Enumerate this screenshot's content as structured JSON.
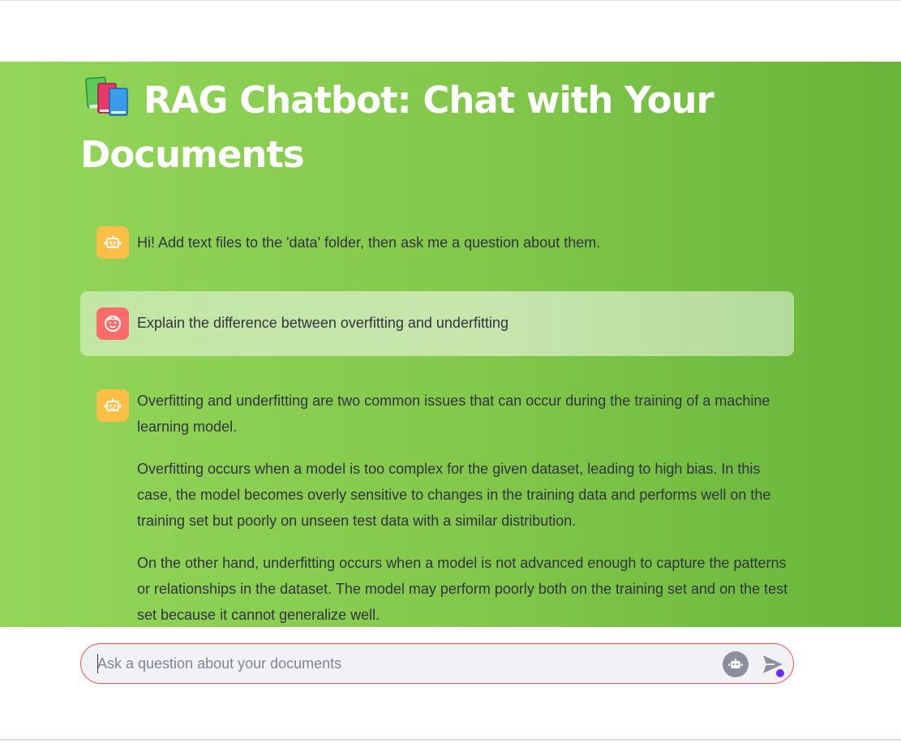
{
  "header": {
    "title": "RAG Chatbot: Chat with Your Documents",
    "title_icon": "books-icon"
  },
  "chat": {
    "messages": [
      {
        "role": "assistant",
        "avatar_icon": "robot-icon",
        "paragraphs": [
          "Hi! Add text files to the 'data' folder, then ask me a question about them."
        ]
      },
      {
        "role": "user",
        "avatar_icon": "smiley-face-icon",
        "paragraphs": [
          "Explain the difference between overfitting and underfitting"
        ]
      },
      {
        "role": "assistant",
        "avatar_icon": "robot-icon",
        "paragraphs": [
          "Overfitting and underfitting are two common issues that can occur during the training of a machine learning model.",
          "Overfitting occurs when a model is too complex for the given dataset, leading to high bias. In this case, the model becomes overly sensitive to changes in the training data and performs well on the training set but poorly on unseen test data with a similar distribution.",
          "On the other hand, underfitting occurs when a model is not advanced enough to capture the patterns or relationships in the dataset. The model may perform poorly both on the training set and on the test set because it cannot generalize well."
        ]
      }
    ]
  },
  "input": {
    "placeholder": "Ask a question about your documents",
    "value": "",
    "bot_icon": "robot-icon",
    "send_icon": "send-icon"
  },
  "colors": {
    "gradient_start": "#93d65a",
    "gradient_end": "#67b53a",
    "bot_avatar": "#ffbf47",
    "user_avatar": "#ff6b6b",
    "input_border": "#ff4b4b",
    "title_text": "#ffffff",
    "body_text": "#31333f"
  }
}
